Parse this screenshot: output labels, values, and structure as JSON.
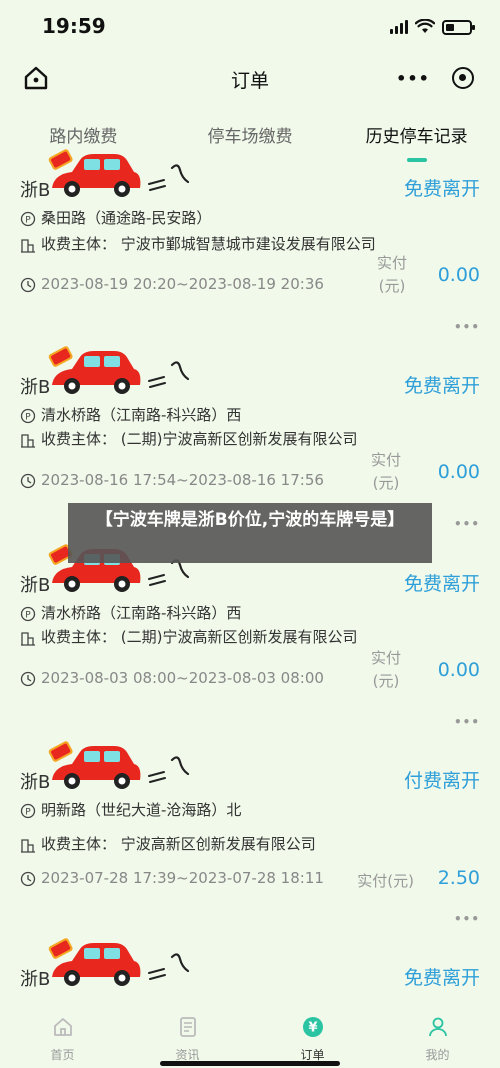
{
  "status": {
    "time": "19:59",
    "battery_level": 0.35
  },
  "nav": {
    "title": "订单",
    "more": "•••"
  },
  "tabs": [
    {
      "label": "路内缴费",
      "active": false
    },
    {
      "label": "停车场缴费",
      "active": false
    },
    {
      "label": "历史停车记录",
      "active": true
    }
  ],
  "paid_label_line1": "实付",
  "paid_label_line2": "(元)",
  "paid_label_inline": "实付(元)",
  "card_more": "•••",
  "orders": [
    {
      "plate": "浙B",
      "status": "免费离开",
      "location": "桑田路（通途路-民安路）",
      "payee": "收费主体：  宁波市鄞城智慧城市建设发展有限公司",
      "time": "2023-08-19 20:20~2023-08-19 20:36",
      "amount": "0.00"
    },
    {
      "plate": "浙B",
      "status": "免费离开",
      "location": "清水桥路（江南路-科兴路）西",
      "payee": "收费主体：  (二期)宁波高新区创新发展有限公司",
      "time": "2023-08-16 17:54~2023-08-16 17:56",
      "amount": "0.00"
    },
    {
      "plate": "浙B",
      "status": "免费离开",
      "location": "清水桥路（江南路-科兴路）西",
      "payee": "收费主体：  (二期)宁波高新区创新发展有限公司",
      "time": "2023-08-03 08:00~2023-08-03 08:00",
      "amount": "0.00"
    },
    {
      "plate": "浙B",
      "status": "付费离开",
      "location": "明新路（世纪大道-沧海路）北",
      "payee": "收费主体：  宁波高新区创新发展有限公司",
      "time": "2023-07-28 17:39~2023-07-28 18:11",
      "amount": "2.50"
    },
    {
      "plate": "浙B",
      "status": "免费离开"
    }
  ],
  "overlay_text": "【宁波车牌是浙B价位,宁波的车牌号是】",
  "tabbar": [
    {
      "label": "首页",
      "icon": "home-icon",
      "active": false
    },
    {
      "label": "资讯",
      "icon": "news-icon",
      "active": false
    },
    {
      "label": "订单",
      "icon": "order-icon",
      "active": true
    },
    {
      "label": "我的",
      "icon": "user-icon",
      "active": false
    }
  ],
  "colors": {
    "accent": "#2bc4a2",
    "link": "#2f9fd9",
    "background": "#f0f9ea",
    "car": "#e8271f"
  }
}
